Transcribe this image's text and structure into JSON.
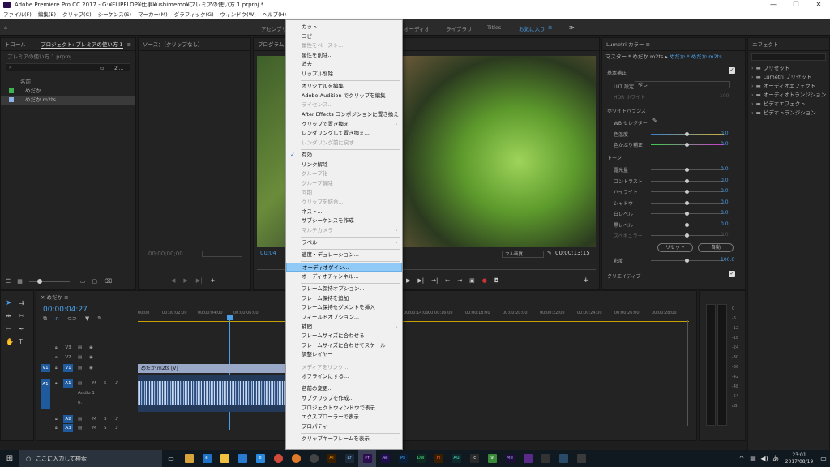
{
  "titlebar": {
    "title": "Adobe Premiere Pro CC 2017 - G:¥FLIPFLOP¥仕事¥ushimemo¥プレミアの使い方 1.prproj *",
    "minimize": "—",
    "maximize": "❐",
    "close": "✕"
  },
  "menubar": [
    "ファイル(F)",
    "編集(E)",
    "クリップ(C)",
    "シーケンス(S)",
    "マーカー(M)",
    "グラフィック(G)",
    "ウィンドウ(W)",
    "ヘルプ(H)"
  ],
  "workspaces": {
    "left": "アセンブリ",
    "audio": "オーディオ",
    "library": "ライブラリ",
    "titles": "Titles",
    "favorites": "お気に入り",
    "more": "≫"
  },
  "project": {
    "tab_control": "トロール",
    "tab_project": "プロジェクト: プレミアの使い方 1",
    "file": "プレミアの使い方 1.prproj",
    "count": "2 ...",
    "col_name": "名前",
    "items": [
      "めだか",
      "めだか.m2ts"
    ]
  },
  "source": {
    "title": "ソース：（クリップなし）",
    "timecode": "00;00;00;00"
  },
  "program": {
    "title": "プログラム: め",
    "timecode_left": "00:04",
    "timecode_right": "00:00:13:15",
    "fit": "フル画質"
  },
  "lumetri": {
    "tab": "Lumetri カラー",
    "master": "マスター * めだか.m2ts",
    "seq": "めだか * めだか.m2ts",
    "basic": "基本補正",
    "lut_label": "LUT 設定",
    "lut_value": "なし",
    "hdr": "HDR ホワイト",
    "hdr_val": "100",
    "wb_section": "ホワイトバランス",
    "wb_selector": "WB セレクター",
    "sliders": [
      {
        "label": "色温度",
        "value": "0.0"
      },
      {
        "label": "色かぶり補正",
        "value": "0.0"
      }
    ],
    "tone_section": "トーン",
    "tone": [
      {
        "label": "露光量",
        "value": "0.0"
      },
      {
        "label": "コントラスト",
        "value": "0.0"
      },
      {
        "label": "ハイライト",
        "value": "0.0"
      },
      {
        "label": "シャドウ",
        "value": "0.0"
      },
      {
        "label": "白レベル",
        "value": "0.0"
      },
      {
        "label": "黒レベル",
        "value": "0.0"
      },
      {
        "label": "スペキュラー",
        "value": "0.0"
      }
    ],
    "reset": "リセット",
    "auto": "自動",
    "saturation": "彩度",
    "saturation_val": "100.0",
    "creative": "クリエイティブ"
  },
  "effects": {
    "tab": "エフェクト",
    "items": [
      "プリセット",
      "Lumetri プリセット",
      "オーディオエフェクト",
      "オーディオトランジション",
      "ビデオエフェクト",
      "ビデオトランジション"
    ]
  },
  "timeline": {
    "tab": "めだか",
    "timecode": "00:00:04:27",
    "ruler": [
      "00:00",
      "00:00:02:00",
      "00:00:04:00",
      "00:00:06:00",
      "00:00:14:00",
      "00:00:16:00",
      "00:00:18:00",
      "00:00:20:00",
      "00:00:22:00",
      "00:00:24:00",
      "00:00:26:00",
      "00:00:28:00"
    ],
    "video_tracks": [
      "V3",
      "V2",
      "V1"
    ],
    "audio_tracks": [
      "A1",
      "A2",
      "A3"
    ],
    "audio1_name": "Audio 1",
    "audio1_vol": "0.",
    "clip_v": "めだか.m2ts [V]",
    "src_v": "V1",
    "src_a": "A1"
  },
  "meter": [
    "0",
    "-6",
    "-12",
    "-18",
    "-24",
    "-30",
    "-36",
    "-42",
    "-48",
    "-54",
    "dB"
  ],
  "context_menu": [
    {
      "label": "カット",
      "state": "normal"
    },
    {
      "label": "コピー",
      "state": "normal"
    },
    {
      "label": "属性をペースト...",
      "state": "disabled"
    },
    {
      "label": "属性を削除...",
      "state": "normal"
    },
    {
      "label": "消去",
      "state": "normal"
    },
    {
      "label": "リップル削除",
      "state": "normal"
    },
    {
      "label": "オリジナルを編集",
      "state": "normal"
    },
    {
      "label": "Adobe Audition でクリップを編集",
      "state": "normal"
    },
    {
      "label": "ライセンス...",
      "state": "disabled"
    },
    {
      "label": "After Effects コンポジションに置き換え",
      "state": "normal"
    },
    {
      "label": "クリップで置き換え",
      "state": "normal",
      "sub": true
    },
    {
      "label": "レンダリングして置き換え...",
      "state": "normal"
    },
    {
      "label": "レンダリング前に戻す",
      "state": "disabled"
    },
    {
      "label": "有効",
      "state": "checked"
    },
    {
      "label": "リンク解除",
      "state": "normal"
    },
    {
      "label": "グループ化",
      "state": "disabled"
    },
    {
      "label": "グループ解除",
      "state": "disabled"
    },
    {
      "label": "同期",
      "state": "disabled"
    },
    {
      "label": "クリップを結合...",
      "state": "disabled"
    },
    {
      "label": "ネスト...",
      "state": "normal"
    },
    {
      "label": "サブシーケンスを作成",
      "state": "normal"
    },
    {
      "label": "マルチカメラ",
      "state": "disabled",
      "sub": true
    },
    {
      "label": "ラベル",
      "state": "normal",
      "sub": true
    },
    {
      "label": "速度・デュレーション...",
      "state": "normal"
    },
    {
      "label": "オーディオゲイン...",
      "state": "highlight"
    },
    {
      "label": "オーディオチャンネル...",
      "state": "normal"
    },
    {
      "label": "フレーム保持オプション...",
      "state": "normal"
    },
    {
      "label": "フレーム保持を追加",
      "state": "normal"
    },
    {
      "label": "フレーム保持セグメントを挿入",
      "state": "normal"
    },
    {
      "label": "フィールドオプション...",
      "state": "normal"
    },
    {
      "label": "補間",
      "state": "normal",
      "sub": true
    },
    {
      "label": "フレームサイズに合わせる",
      "state": "normal"
    },
    {
      "label": "フレームサイズに合わせてスケール",
      "state": "normal"
    },
    {
      "label": "調整レイヤー",
      "state": "normal"
    },
    {
      "label": "メディアをリンク...",
      "state": "disabled"
    },
    {
      "label": "オフラインにする...",
      "state": "normal"
    },
    {
      "label": "名前の変更...",
      "state": "normal"
    },
    {
      "label": "サブクリップを作成...",
      "state": "normal"
    },
    {
      "label": "プロジェクトウィンドウで表示",
      "state": "normal"
    },
    {
      "label": "エクスプローラーで表示...",
      "state": "normal"
    },
    {
      "label": "プロパティ",
      "state": "normal"
    },
    {
      "label": "クリップキーフレームを表示",
      "state": "normal",
      "sub": true
    }
  ],
  "taskbar": {
    "search": "ここに入力して検索",
    "time": "23:01",
    "date": "2017/08/19",
    "apps": [
      "Ai",
      "Lr",
      "Pr",
      "Ae",
      "Ps",
      "Dw",
      "Fl",
      "Au",
      "Ic",
      "Me"
    ]
  },
  "colors": {
    "accent": "#4a9fe8",
    "menu_highlight": "#91c9f7",
    "track_blue": "#1f5a9c",
    "taskbar": "#101820"
  }
}
